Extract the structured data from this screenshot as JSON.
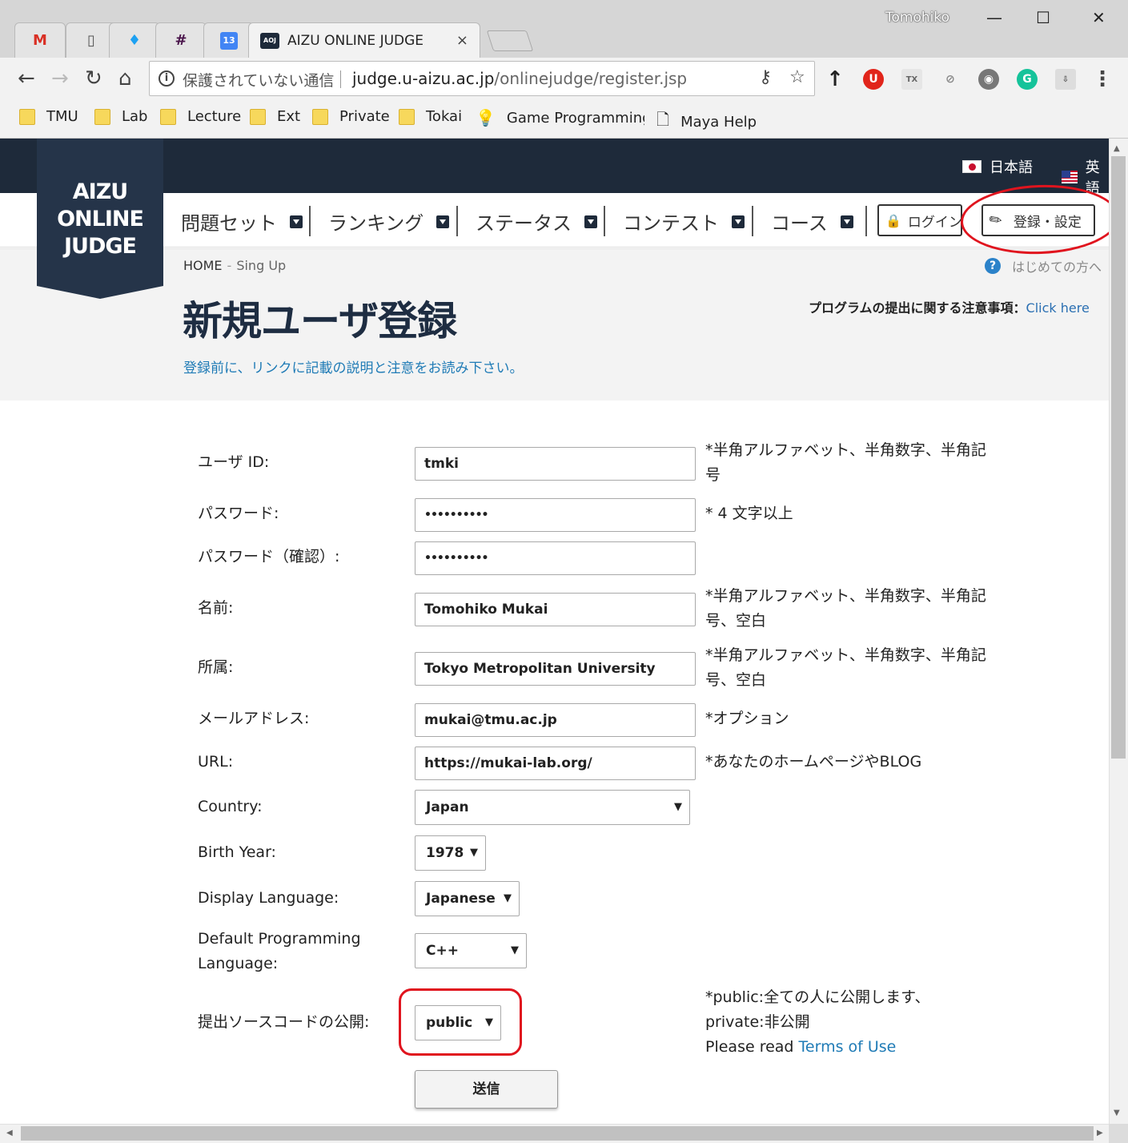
{
  "browser": {
    "tabs": [
      {
        "icon": "gmail-icon",
        "glyph": "M",
        "color": "#d93025"
      },
      {
        "icon": "document-icon",
        "glyph": "▯",
        "color": "#555555"
      },
      {
        "icon": "twitter-icon",
        "glyph": "♦",
        "color": "#1da1f2"
      },
      {
        "icon": "slack-icon",
        "glyph": "#",
        "color": "#4a154b"
      },
      {
        "icon": "calendar-icon",
        "glyph": "13",
        "color": "#4285f4"
      }
    ],
    "active_tab": {
      "favicon": "AOJ",
      "title": "AIZU ONLINE JUDGE",
      "close": "×"
    },
    "profile": "Tomohiko",
    "window_controls": {
      "minimize": "—",
      "maximize": "☐",
      "close": "✕"
    },
    "nav": {
      "back": "←",
      "forward": "→",
      "reload": "↻",
      "home": "⌂"
    },
    "security": "保護されていない通信",
    "url_host": "judge.u-aizu.ac.jp",
    "url_path": "/onlinejudge/register.jsp",
    "omnibox_icons": {
      "key": "⚷",
      "star": "☆"
    },
    "extensions": [
      {
        "icon": "upload-arrow-icon",
        "glyph": "↑",
        "bg": "transparent",
        "fg": "#222222"
      },
      {
        "icon": "ublock-icon",
        "glyph": "U",
        "bg": "#e1251b",
        "fg": "#ffffff"
      },
      {
        "icon": "tex-icon",
        "glyph": "TX",
        "bg": "#e6e6e6",
        "fg": "#666666"
      },
      {
        "icon": "cast-off-icon",
        "glyph": "⊘",
        "bg": "transparent",
        "fg": "#888888"
      },
      {
        "icon": "film-reel-icon",
        "glyph": "◉",
        "bg": "#777777",
        "fg": "#ffffff"
      },
      {
        "icon": "grammarly-icon",
        "glyph": "G",
        "bg": "#15c39a",
        "fg": "#ffffff"
      },
      {
        "icon": "download-icon",
        "glyph": "⇩",
        "bg": "#dddddd",
        "fg": "#555555"
      },
      {
        "icon": "menu-icon",
        "glyph": "⋮",
        "bg": "transparent",
        "fg": "#444444"
      }
    ],
    "bookmarks": [
      {
        "label": "TMU",
        "kind": "folder"
      },
      {
        "label": "Lab",
        "kind": "folder"
      },
      {
        "label": "Lecture",
        "kind": "folder"
      },
      {
        "label": "Ext",
        "kind": "folder"
      },
      {
        "label": "Private",
        "kind": "folder"
      },
      {
        "label": "Tokai",
        "kind": "folder"
      },
      {
        "label": "Game Programming",
        "kind": "bulb"
      },
      {
        "label": "Maya Help",
        "kind": "page"
      }
    ]
  },
  "site": {
    "logo": [
      "AIZU",
      "ONLINE",
      "JUDGE"
    ],
    "lang_jp": "日本語",
    "lang_en": "英語",
    "nav": [
      "問題セット",
      "ランキング",
      "ステータス",
      "コンテスト",
      "コース"
    ],
    "login": "ログイン",
    "register": "登録・設定",
    "breadcrumb_home": "HOME",
    "breadcrumb_sep": "-",
    "breadcrumb_current": "Sing Up",
    "help": "はじめての方へ",
    "title": "新規ユーザ登録",
    "note_label": "プログラムの提出に関する注意事項：",
    "note_link": "Click here",
    "intro": "登録前に、リンクに記載の説明と注意をお読み下さい。"
  },
  "form": {
    "user_id": {
      "label": "ユーザ ID:",
      "value": "tmki",
      "hint": "*半角アルファベット、半角数字、半角記号"
    },
    "password": {
      "label": "パスワード:",
      "value": "••••••••••",
      "hint": "* 4 文字以上"
    },
    "password_confirm": {
      "label": "パスワード（確認）:",
      "value": "••••••••••"
    },
    "name": {
      "label": "名前:",
      "value": "Tomohiko Mukai",
      "hint": "*半角アルファベット、半角数字、半角記号、空白"
    },
    "affiliation": {
      "label": "所属:",
      "value": "Tokyo Metropolitan University",
      "hint": "*半角アルファベット、半角数字、半角記号、空白"
    },
    "email": {
      "label": "メールアドレス:",
      "value": "mukai@tmu.ac.jp",
      "hint": "*オプション"
    },
    "url": {
      "label": "URL:",
      "value": "https://mukai-lab.org/",
      "hint": "*あなたのホームページやBLOG"
    },
    "country": {
      "label": "Country:",
      "value": "Japan"
    },
    "birth_year": {
      "label": "Birth Year:",
      "value": "1978"
    },
    "display_language": {
      "label": "Display Language:",
      "value": "Japanese"
    },
    "programming_language": {
      "label": "Default Programming Language:",
      "value": "C++"
    },
    "source_visibility": {
      "label": "提出ソースコードの公開:",
      "value": "public",
      "hint_public": "*public:全ての人に公開します、",
      "hint_private": "private:非公開",
      "hint_read": "Please read ",
      "terms": "Terms of Use"
    },
    "select_arrow": "▼",
    "submit": "送信"
  },
  "colors": {
    "header_dark": "#1e2a3a",
    "link_blue": "#1f7bb6",
    "annotation_red": "#e0141e"
  }
}
